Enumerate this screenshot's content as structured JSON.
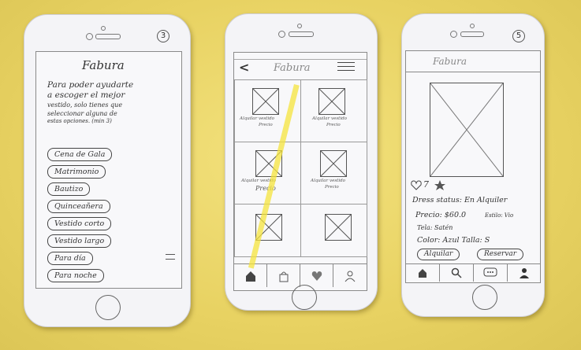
{
  "phone1": {
    "page_number": "3",
    "title": "Fabura",
    "instructions": [
      "Para poder ayudarte",
      "a escoger el mejor",
      "vestido, solo tienes que",
      "seleccionar alguna de",
      "estas opciones. (min 3)"
    ],
    "options": [
      "Cena de Gala",
      "Matrimonio",
      "Bautizo",
      "Quinceañera",
      "Vestido corto",
      "Vestido largo",
      "Para día",
      "Para noche"
    ]
  },
  "phone2": {
    "back": "<",
    "title": "Fabura",
    "captions": [
      "Alquilar vestido",
      "Alquilar vestido",
      "Alquilar vestido",
      "Alquilar vestido"
    ],
    "captions_sub": [
      "Precio",
      "Precio",
      "Precio",
      "Precio"
    ],
    "tabs": [
      "home",
      "bag",
      "heart",
      "user"
    ]
  },
  "phone3": {
    "page_number": "5",
    "title": "Fabura",
    "likes": "7",
    "dress_status": "Dress status: En Alquiler",
    "price": "Precio: $60.0",
    "size_label": "Estilo: Vio",
    "fabric": "Tela: Satén",
    "color_size": "Color: Azul  Talla: S",
    "rent_button": "Alquilar",
    "reserve_button": "Reservar",
    "tabs": [
      "home",
      "search",
      "chat",
      "user"
    ]
  }
}
